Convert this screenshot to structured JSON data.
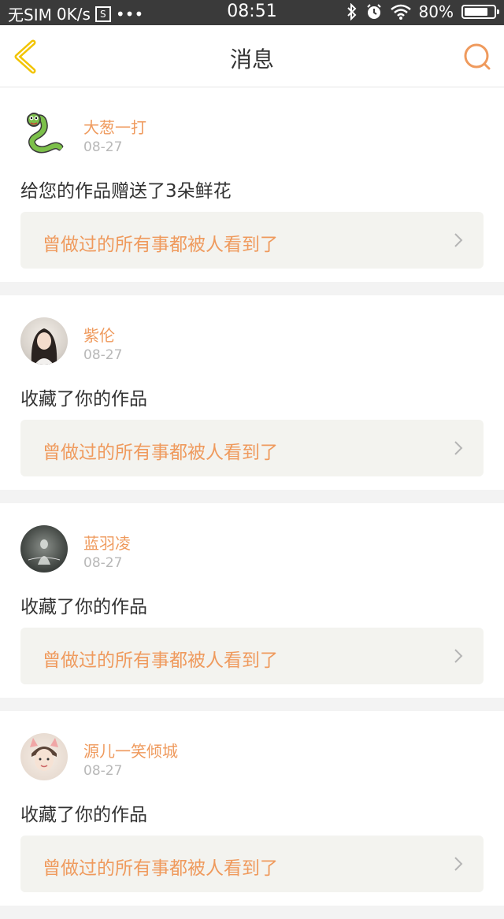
{
  "status_bar": {
    "carrier": "无SIM",
    "speed": "0K/s",
    "sim_icon_text": "S",
    "dots": "•••",
    "time": "08:51",
    "battery": "80%",
    "battery_level": 0.8
  },
  "nav": {
    "title": "消息"
  },
  "colors": {
    "accent": "#ef9a5d",
    "back_arrow": "#f2c400"
  },
  "messages": [
    {
      "user": "大葱一打",
      "date": "08-27",
      "action": "给您的作品赠送了3朵鲜花",
      "work_title": "曾做过的所有事都被人看到了",
      "avatar_icon": "snake-avatar"
    },
    {
      "user": "紫伦",
      "date": "08-27",
      "action": "收藏了你的作品",
      "work_title": "曾做过的所有事都被人看到了",
      "avatar_icon": "girl-photo-avatar"
    },
    {
      "user": "蓝羽凌",
      "date": "08-27",
      "action": "收藏了你的作品",
      "work_title": "曾做过的所有事都被人看到了",
      "avatar_icon": "dark-photo-avatar"
    },
    {
      "user": "源儿一笑倾城",
      "date": "08-27",
      "action": "收藏了你的作品",
      "work_title": "曾做过的所有事都被人看到了",
      "avatar_icon": "boy-photo-avatar"
    }
  ]
}
